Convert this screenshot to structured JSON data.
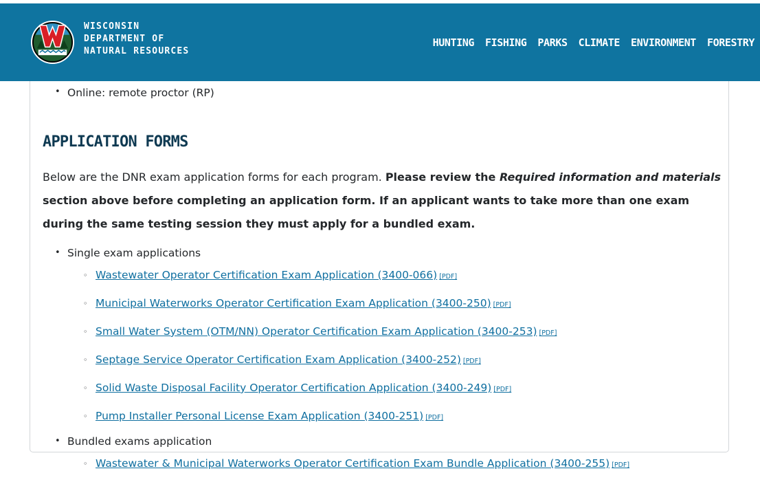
{
  "header": {
    "brand_lines": [
      "WISCONSIN",
      "DEPARTMENT OF",
      "NATURAL RESOURCES"
    ],
    "nav": [
      "HUNTING",
      "FISHING",
      "PARKS",
      "CLIMATE",
      "ENVIRONMENT",
      "FORESTRY"
    ]
  },
  "top_item": "Online: remote proctor (RP)",
  "section": {
    "title": "APPLICATION FORMS",
    "intro_plain": "Below are the DNR exam application forms for each program. ",
    "intro_bold_1": "Please review the ",
    "intro_italic": "Required information and materials",
    "intro_bold_2": " section above before completing an application form. If an applicant wants to take more than one exam during the same testing session they must apply for a bundled exam."
  },
  "groups": [
    {
      "label": "Single exam applications",
      "links": [
        {
          "text": "Wastewater Operator Certification Exam Application (3400-066)",
          "tag": "[PDF]"
        },
        {
          "text": "Municipal Waterworks Operator Certification Exam Application (3400-250)",
          "tag": "[PDF]"
        },
        {
          "text": "Small Water System (OTM/NN) Operator Certification Exam Application (3400-253)",
          "tag": "[PDF]"
        },
        {
          "text": "Septage Service Operator Certification Exam Application (3400-252)",
          "tag": "[PDF]"
        },
        {
          "text": "Solid Waste Disposal Facility Operator Certification Application (3400-249)",
          "tag": "[PDF]"
        },
        {
          "text": "Pump Installer Personal License Exam Application (3400-251)",
          "tag": "[PDF]"
        }
      ]
    },
    {
      "label": "Bundled exams application",
      "links": [
        {
          "text": "Wastewater & Municipal Waterworks Operator Certification Exam Bundle Application (3400-255)",
          "tag": "[PDF]"
        }
      ]
    }
  ]
}
